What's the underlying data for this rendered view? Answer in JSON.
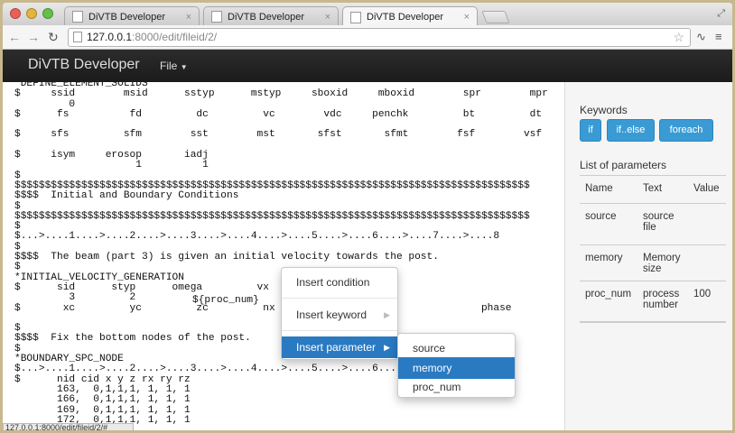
{
  "browser": {
    "tabs": [
      {
        "title": "DiVTB Developer",
        "close": "×"
      },
      {
        "title": "DiVTB Developer",
        "close": "×"
      },
      {
        "title": "DiVTB Developer",
        "close": "×"
      }
    ],
    "url_host": "127.0.0.1",
    "url_rest": ":8000/edit/fileid/2/",
    "status_url": "127.0.0.1:8000/edit/fileid/2/#"
  },
  "navbar": {
    "brand": "DiVTB Developer",
    "file_menu": "File"
  },
  "editor": {
    "lines": [
      "*DEFINE_ELEMENT_SOLIDS",
      "$     ssid        msid      sstyp      mstyp     sboxid     mboxid        spr        mpr",
      "         0",
      "$      fs          fd         dc         vc        vdc     penchk         bt         dt",
      "",
      "$     sfs         sfm        sst        mst       sfst       sfmt        fsf        vsf",
      "",
      "$     isym     erosop       iadj",
      "                    1          1",
      "$",
      "$$$$$$$$$$$$$$$$$$$$$$$$$$$$$$$$$$$$$$$$$$$$$$$$$$$$$$$$$$$$$$$$$$$$$$$$$$$$$$$$$$$$$",
      "$$$$  Initial and Boundary Conditions",
      "$",
      "$$$$$$$$$$$$$$$$$$$$$$$$$$$$$$$$$$$$$$$$$$$$$$$$$$$$$$$$$$$$$$$$$$$$$$$$$$$$$$$$$$$$$",
      "$",
      "$...>....1....>....2....>....3....>....4....>....5....>....6....>....7....>....8",
      "$",
      "$$$$  The beam (part 3) is given an initial velocity towards the post.",
      "$",
      "*INITIAL_VELOCITY_GENERATION",
      "$      sid      styp      omega         vx",
      "         3         2",
      "$       xc         yc         zc         nx                                  phase",
      "",
      "$",
      "$$$$  Fix the bottom nodes of the post.",
      "$",
      "*BOUNDARY_SPC_NODE",
      "$...>....1....>....2....>....3....>....4....>....5....>....6....>....7....>....8",
      "$      nid cid x y z rx ry rz",
      "       163,  0,1,1,1, 1, 1, 1",
      "       166,  0,1,1,1, 1, 1, 1",
      "       169,  0,1,1,1, 1, 1, 1",
      "       172,  0,1,1,1, 1, 1, 1"
    ],
    "inserted_param": "${proc_num}"
  },
  "sidebar": {
    "keywords_title": "Keywords",
    "keywords": [
      "if",
      "if..else",
      "foreach"
    ],
    "params_title": "List of parameters",
    "columns": [
      "Name",
      "Text",
      "Value"
    ],
    "rows": [
      {
        "name": "source",
        "text": "source file",
        "value": ""
      },
      {
        "name": "memory",
        "text": "Memory size",
        "value": ""
      },
      {
        "name": "proc_num",
        "text": "process number",
        "value": "100"
      }
    ]
  },
  "context_menu": {
    "items": [
      "Insert condition",
      "Insert keyword",
      "Insert parameter"
    ],
    "submenu": [
      "source",
      "memory",
      "proc_num"
    ]
  },
  "colors": {
    "accent": "#3a9bd4",
    "menu_active": "#2a7ac2",
    "navbar": "#1b1b1b"
  }
}
